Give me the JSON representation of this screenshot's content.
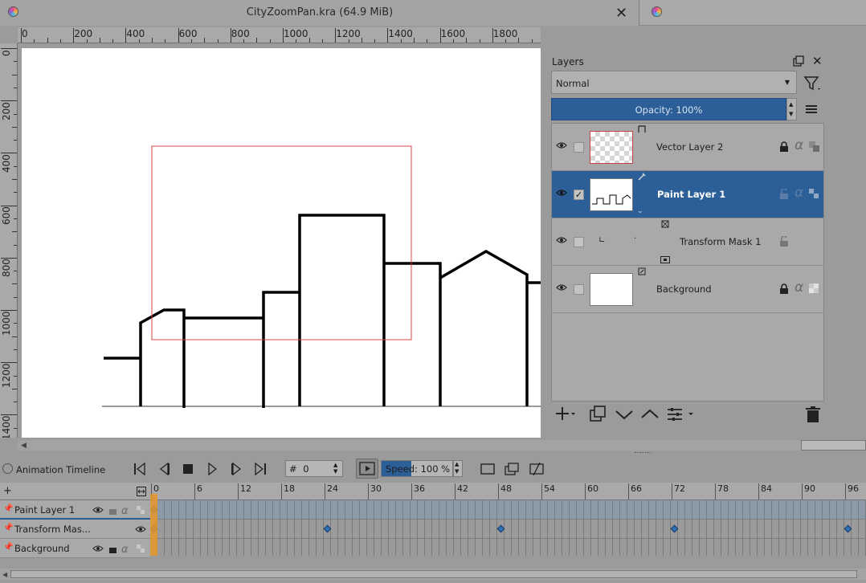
{
  "window": {
    "doc_title": "CityZoomPan.kra (64.9 MiB)",
    "close_glyph": "✕"
  },
  "ruler": {
    "h_labels": [
      "0",
      "200",
      "400",
      "600",
      "800",
      "1000",
      "1200",
      "1400",
      "1600",
      "1800"
    ],
    "v_labels": [
      "0",
      "200",
      "400",
      "600",
      "800",
      "1000",
      "1200",
      "1400"
    ]
  },
  "layers_docker": {
    "title": "Layers",
    "blend_mode": "Normal",
    "opacity_label": "Opacity: 100%",
    "layers": [
      {
        "name": "Vector Layer 2",
        "checked": false,
        "selected": false,
        "thumb": "transparent",
        "type_icon": "vector-layer-icon"
      },
      {
        "name": "Paint Layer 1",
        "checked": true,
        "selected": true,
        "thumb": "sketch",
        "type_icon": "paint-layer-icon"
      },
      {
        "name": "Transform Mask 1",
        "checked": false,
        "selected": false,
        "thumb": "mask",
        "type_icon": "transform-mask-icon"
      },
      {
        "name": "Background",
        "checked": false,
        "selected": false,
        "thumb": "white",
        "type_icon": "paint-layer-icon"
      }
    ],
    "check_glyph": "✓"
  },
  "animation_timeline": {
    "title": "Animation Timeline",
    "frame_prefix": "#",
    "current_frame": "0",
    "speed_label": "Speed: 100 %",
    "speed_fraction": 0.42,
    "frame_ruler": [
      "0",
      "6",
      "12",
      "18",
      "24",
      "30",
      "36",
      "42",
      "48",
      "54",
      "60",
      "66",
      "72",
      "78",
      "84",
      "90",
      "96"
    ],
    "tracks": [
      {
        "name": "Paint Layer 1",
        "keyframes": [
          0
        ]
      },
      {
        "name": "Transform Mas...",
        "keyframes": [
          0,
          24,
          48,
          72,
          96
        ]
      },
      {
        "name": "Background",
        "keyframes": []
      }
    ]
  },
  "colors": {
    "accent": "#2c5f98",
    "playhead": "#e8962a",
    "selection_frame": "#d44444"
  }
}
